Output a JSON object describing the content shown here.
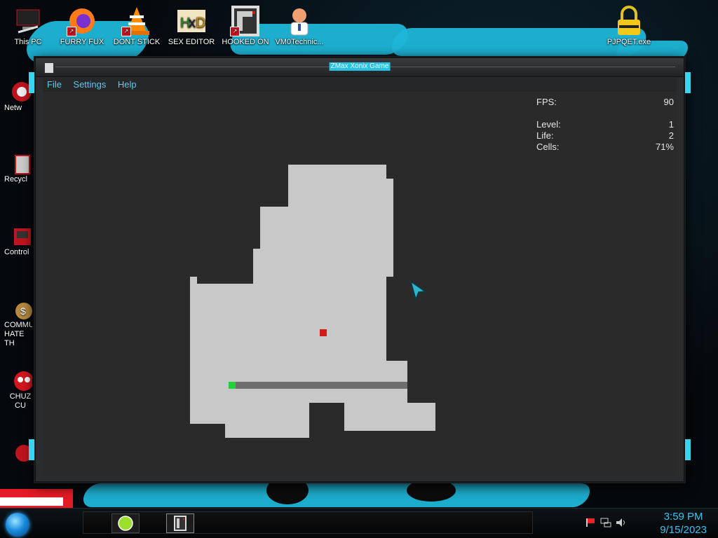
{
  "desktop": {
    "top_icons": [
      {
        "label": "This PC",
        "icon": "computer-icon"
      },
      {
        "label": "FURRY FUX",
        "icon": "firefox-icon"
      },
      {
        "label": "DONT STICK",
        "icon": "vlc-cone-icon"
      },
      {
        "label": "SEX EDITOR",
        "icon": "hxd-icon"
      },
      {
        "label": "HOOKED ON",
        "icon": "xonix-icon"
      },
      {
        "label": "VM0Technic...",
        "icon": "doctor-avatar-icon"
      },
      {
        "label": "PJPQET.exe",
        "icon": "padlock-icon"
      }
    ],
    "side_icons": [
      {
        "label": "Netw",
        "icon": "network-icon"
      },
      {
        "label": "Recycl",
        "icon": "recycle-bin-icon"
      },
      {
        "label": "Control",
        "icon": "control-panel-icon"
      },
      {
        "label": "COMMU HATE TH",
        "icon": "money-bag-icon"
      },
      {
        "label": "CHUZ CU",
        "icon": "red-creature-icon"
      },
      {
        "label": "",
        "icon": "red-app-icon"
      }
    ]
  },
  "window": {
    "title": "ZMax Xonix Game",
    "menu": [
      "File",
      "Settings",
      "Help"
    ],
    "stats": {
      "fps_label": "FPS:",
      "fps_value": "90",
      "level_label": "Level:",
      "level_value": "1",
      "life_label": "Life:",
      "life_value": "2",
      "cells_label": "Cells:",
      "cells_value": "71%"
    },
    "colors": {
      "claimed": "#c8c8c8",
      "enemy": "#d11a1a",
      "trail": "#6e6e6e",
      "player": "#1ed33a",
      "menu": "#5ec8ef",
      "title_bg": "#29c2e0"
    }
  },
  "taskbar": {
    "time": "3:59 PM",
    "date": "9/15/2023",
    "pinned": [
      "lime-app-icon",
      "xonix-icon"
    ],
    "tray": [
      "flag-alert-icon",
      "network-icon",
      "volume-icon"
    ]
  }
}
